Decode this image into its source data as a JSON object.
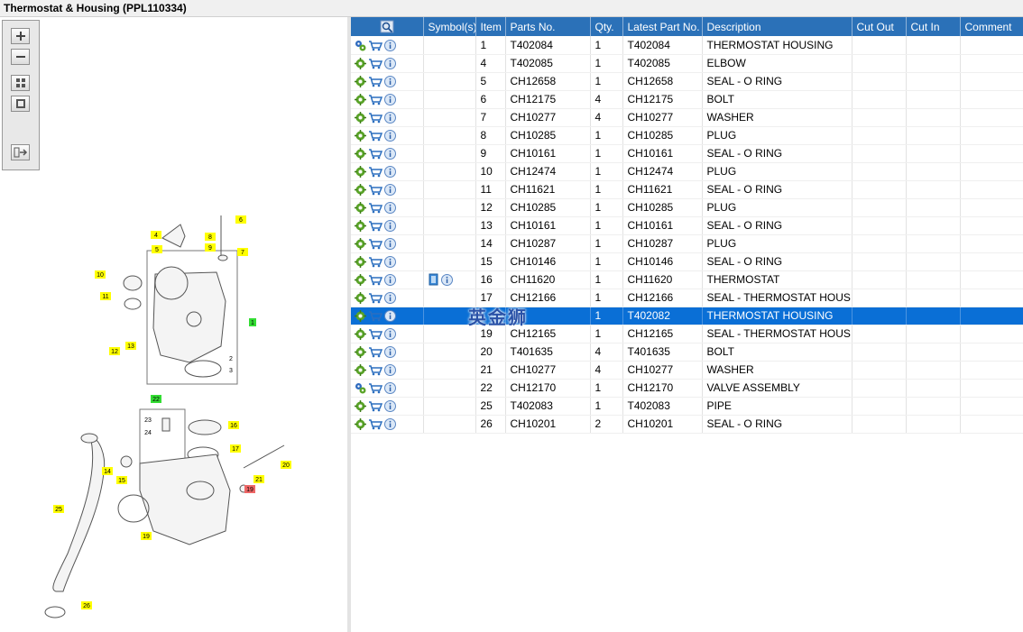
{
  "window": {
    "title": "Thermostat & Housing (PPL110334)"
  },
  "toolbar": {
    "buttons": [
      {
        "name": "zoom-in-button",
        "icon": "plus-icon"
      },
      {
        "name": "zoom-out-button",
        "icon": "minus-icon"
      },
      {
        "name": "fit-all-button",
        "icon": "grid-icon"
      },
      {
        "name": "fit-window-button",
        "icon": "square-icon"
      },
      {
        "name": "export-button",
        "icon": "export-icon"
      }
    ]
  },
  "diagram": {
    "callouts": [
      "6",
      "4",
      "8",
      "5",
      "9",
      "7",
      "10",
      "11",
      "1",
      "13",
      "12",
      "2",
      "3",
      "22",
      "16",
      "23",
      "24",
      "17",
      "20",
      "14",
      "15",
      "21",
      "19",
      "25",
      "19",
      "26"
    ],
    "highlighted_green": [
      "1",
      "22"
    ],
    "highlighted_red": [
      "19"
    ]
  },
  "table": {
    "columns": [
      "",
      "Symbol(s)",
      "Item",
      "Parts No.",
      "Qty.",
      "Latest Part No.",
      "Description",
      "Cut Out",
      "Cut In",
      "Comment"
    ],
    "rows": [
      {
        "item": "1",
        "part": "T402084",
        "qty": "1",
        "latest": "T402084",
        "desc": "THERMOSTAT HOUSING",
        "icon": "gears"
      },
      {
        "item": "4",
        "part": "T402085",
        "qty": "1",
        "latest": "T402085",
        "desc": "ELBOW",
        "icon": "gear"
      },
      {
        "item": "5",
        "part": "CH12658",
        "qty": "1",
        "latest": "CH12658",
        "desc": "SEAL - O RING",
        "icon": "gear"
      },
      {
        "item": "6",
        "part": "CH12175",
        "qty": "4",
        "latest": "CH12175",
        "desc": "BOLT",
        "icon": "gear"
      },
      {
        "item": "7",
        "part": "CH10277",
        "qty": "4",
        "latest": "CH10277",
        "desc": "WASHER",
        "icon": "gear"
      },
      {
        "item": "8",
        "part": "CH10285",
        "qty": "1",
        "latest": "CH10285",
        "desc": "PLUG",
        "icon": "gear"
      },
      {
        "item": "9",
        "part": "CH10161",
        "qty": "1",
        "latest": "CH10161",
        "desc": "SEAL - O RING",
        "icon": "gear"
      },
      {
        "item": "10",
        "part": "CH12474",
        "qty": "1",
        "latest": "CH12474",
        "desc": "PLUG",
        "icon": "gear"
      },
      {
        "item": "11",
        "part": "CH11621",
        "qty": "1",
        "latest": "CH11621",
        "desc": "SEAL - O RING",
        "icon": "gear"
      },
      {
        "item": "12",
        "part": "CH10285",
        "qty": "1",
        "latest": "CH10285",
        "desc": "PLUG",
        "icon": "gear"
      },
      {
        "item": "13",
        "part": "CH10161",
        "qty": "1",
        "latest": "CH10161",
        "desc": "SEAL - O RING",
        "icon": "gear"
      },
      {
        "item": "14",
        "part": "CH10287",
        "qty": "1",
        "latest": "CH10287",
        "desc": "PLUG",
        "icon": "gear"
      },
      {
        "item": "15",
        "part": "CH10146",
        "qty": "1",
        "latest": "CH10146",
        "desc": "SEAL - O RING",
        "icon": "gear"
      },
      {
        "item": "16",
        "part": "CH11620",
        "qty": "1",
        "latest": "CH11620",
        "desc": "THERMOSTAT",
        "icon": "gear",
        "extra": "doc"
      },
      {
        "item": "17",
        "part": "CH12166",
        "qty": "1",
        "latest": "CH12166",
        "desc": "SEAL - THERMOSTAT HOUSING",
        "icon": "gear"
      },
      {
        "item": "",
        "part": "",
        "qty": "1",
        "latest": "T402082",
        "desc": "THERMOSTAT HOUSING",
        "icon": "gear",
        "selected": true
      },
      {
        "item": "19",
        "part": "CH12165",
        "qty": "1",
        "latest": "CH12165",
        "desc": "SEAL - THERMOSTAT HOUSING",
        "icon": "gear"
      },
      {
        "item": "20",
        "part": "T401635",
        "qty": "4",
        "latest": "T401635",
        "desc": "BOLT",
        "icon": "gear"
      },
      {
        "item": "21",
        "part": "CH10277",
        "qty": "4",
        "latest": "CH10277",
        "desc": "WASHER",
        "icon": "gear"
      },
      {
        "item": "22",
        "part": "CH12170",
        "qty": "1",
        "latest": "CH12170",
        "desc": "VALVE ASSEMBLY",
        "icon": "gears"
      },
      {
        "item": "25",
        "part": "T402083",
        "qty": "1",
        "latest": "T402083",
        "desc": "PIPE",
        "icon": "gear"
      },
      {
        "item": "26",
        "part": "CH10201",
        "qty": "2",
        "latest": "CH10201",
        "desc": "SEAL - O RING",
        "icon": "gear"
      }
    ]
  },
  "watermark": "英金狮",
  "colors": {
    "header": "#2b71b8",
    "selected_row": "#0a6fd6",
    "callout_yellow": "#ffff00",
    "callout_green": "#33dd33",
    "callout_red": "#ee6666"
  }
}
